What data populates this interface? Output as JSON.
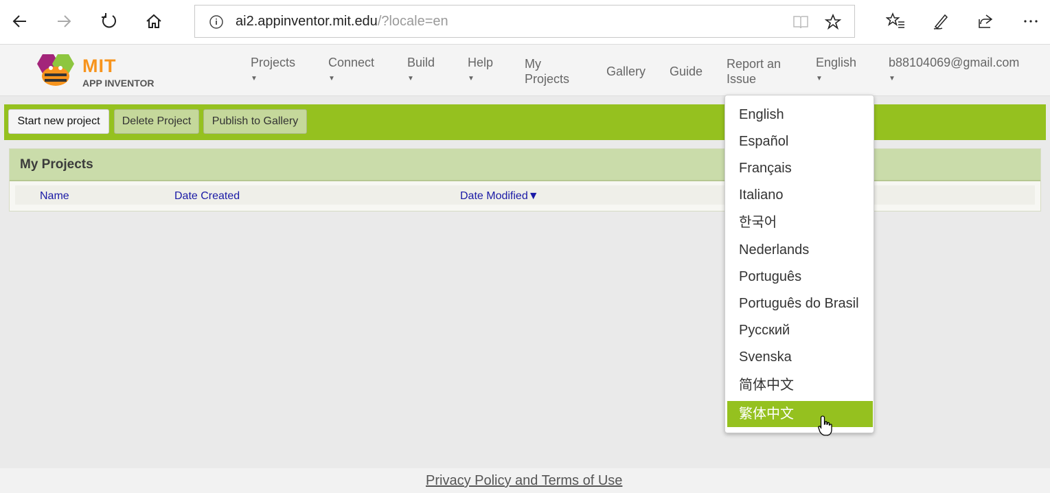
{
  "browser": {
    "url_host": "ai2.appinventor.mit.edu",
    "url_query": "/?locale=en",
    "icons": [
      "back-arrow-icon",
      "forward-arrow-icon",
      "refresh-icon",
      "home-icon",
      "info-icon",
      "reading-view-icon",
      "favorite-star-icon",
      "favorites-list-icon",
      "pen-icon",
      "share-icon",
      "more-icon"
    ]
  },
  "header": {
    "logo_mit": "MIT",
    "logo_app_inventor": "APP INVENTOR",
    "nav": {
      "projects": "Projects",
      "connect": "Connect",
      "build": "Build",
      "help": "Help",
      "my_projects_line1": "My",
      "my_projects_line2": "Projects",
      "gallery": "Gallery",
      "guide": "Guide",
      "report_line1": "Report an",
      "report_line2": "Issue",
      "language": "English",
      "account": "b88104069@gmail.com"
    }
  },
  "toolbar": {
    "start_new_project": "Start new project",
    "delete_project": "Delete Project",
    "publish_to_gallery": "Publish to Gallery"
  },
  "projects_panel": {
    "title": "My Projects",
    "columns": {
      "name": "Name",
      "date_created": "Date Created",
      "date_modified": "Date Modified",
      "sort_indicator": "▼"
    }
  },
  "language_menu": {
    "items": [
      "English",
      "Español",
      "Français",
      "Italiano",
      "한국어",
      "Nederlands",
      "Português",
      "Português do Brasil",
      "Русский",
      "Svenska",
      "简体中文",
      "繁体中文"
    ],
    "selected_index": 11
  },
  "footer": {
    "link": "Privacy Policy and Terms of Use"
  },
  "colors": {
    "accent_green": "#95c11f",
    "panel_header": "#cadcaa",
    "link_blue": "#1a1aa6",
    "logo_orange": "#f7941d"
  }
}
